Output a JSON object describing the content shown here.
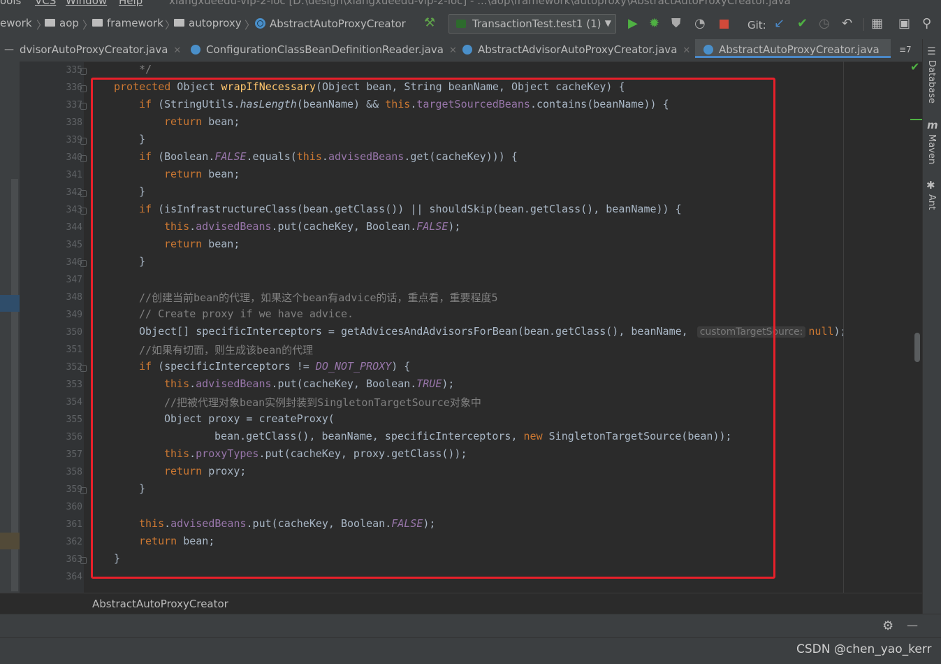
{
  "menubar": {
    "items": [
      "ools",
      "VCS",
      "Window",
      "Help"
    ],
    "window_title": "xiangxueedu-vip-2-ioc [D:\\design\\xiangxueedu-vip-2-ioc] - ...\\aop\\framework\\autoproxy\\AbstractAutoProxyCreator.java"
  },
  "breadcrumb": {
    "items": [
      "ework",
      "aop",
      "framework",
      "autoproxy",
      "AbstractAutoProxyCreator"
    ]
  },
  "toolbar": {
    "run_config": "TransactionTest.test1 (1)",
    "git_label": "Git:"
  },
  "tabs": [
    {
      "label": "dvisorAutoProxyCreator.java"
    },
    {
      "label": "ConfigurationClassBeanDefinitionReader.java"
    },
    {
      "label": "AbstractAdvisorAutoProxyCreator.java"
    },
    {
      "label": "AbstractAutoProxyCreator.java",
      "active": true
    }
  ],
  "tab_overflow": "≡7",
  "line_numbers": [
    "335",
    "336",
    "337",
    "338",
    "339",
    "340",
    "341",
    "342",
    "343",
    "344",
    "345",
    "346",
    "347",
    "348",
    "349",
    "350",
    "351",
    "352",
    "353",
    "354",
    "355",
    "356",
    "357",
    "358",
    "359",
    "360",
    "361",
    "362",
    "363",
    "364"
  ],
  "code": {
    "l335": "*/",
    "l336": {
      "kw": "protected",
      "t1": " Object ",
      "fn": "wrapIfNecessary",
      "t2": "(Object bean, String beanName, Object cacheKey) {"
    },
    "l337": {
      "kw": "if",
      "t1": " (StringUtils.",
      "it": "hasLength",
      "t2": "(beanName) && ",
      "this": "this",
      "dot": ".",
      "fld": "targetSourcedBeans",
      "t3": ".contains(beanName)) {"
    },
    "l338": {
      "kw": "return",
      "t1": " bean;"
    },
    "l339": "}",
    "l340": {
      "kw": "if",
      "t1": " (Boolean.",
      "cst": "FALSE",
      "t2": ".equals(",
      "this": "this",
      "dot": ".",
      "fld": "advisedBeans",
      "t3": ".get(cacheKey))) {"
    },
    "l341": {
      "kw": "return",
      "t1": " bean;"
    },
    "l342": "}",
    "l343": {
      "kw": "if",
      "t1": " (isInfrastructureClass(bean.getClass()) || shouldSkip(bean.getClass(), beanName)) {"
    },
    "l344": {
      "this": "this",
      "dot": ".",
      "fld": "advisedBeans",
      "t1": ".put(cacheKey, Boolean.",
      "cst": "FALSE",
      "t2": ");"
    },
    "l345": {
      "kw": "return",
      "t1": " bean;"
    },
    "l346": "}",
    "l348": "//创建当前bean的代理，如果这个bean有advice的话，重点看，重要程度5",
    "l349": "// Create proxy if we have advice.",
    "l350": {
      "t1": "Object[] specificInterceptors = getAdvicesAndAdvisorsForBean(bean.getClass(), beanName, ",
      "hint": "customTargetSource:",
      "kw": "null",
      "t2": ");"
    },
    "l351": "//如果有切面，则生成该bean的代理",
    "l352": {
      "kw": "if",
      "t1": " (specificInterceptors != ",
      "cst": "DO_NOT_PROXY",
      "t2": ") {"
    },
    "l353": {
      "this": "this",
      "dot": ".",
      "fld": "advisedBeans",
      "t1": ".put(cacheKey, Boolean.",
      "cst": "TRUE",
      "t2": ");"
    },
    "l354": "//把被代理对象bean实例封装到SingletonTargetSource对象中",
    "l355": "Object proxy = createProxy(",
    "l356": {
      "t1": "bean.getClass(), beanName, specificInterceptors, ",
      "kw": "new",
      "t2": " SingletonTargetSource(bean));"
    },
    "l357": {
      "this": "this",
      "dot": ".",
      "fld": "proxyTypes",
      "t1": ".put(cacheKey, proxy.getClass());"
    },
    "l358": {
      "kw": "return",
      "t1": " proxy;"
    },
    "l359": "}",
    "l361": {
      "this": "this",
      "dot": ".",
      "fld": "advisedBeans",
      "t1": ".put(cacheKey, Boolean.",
      "cst": "FALSE",
      "t2": ");"
    },
    "l362": {
      "kw": "return",
      "t1": " bean;"
    },
    "l363": "}"
  },
  "status": {
    "class_name": "AbstractAutoProxyCreator"
  },
  "right_tools": [
    "Database",
    "Maven",
    "Ant"
  ],
  "watermark": "CSDN @chen_yao_kerr"
}
